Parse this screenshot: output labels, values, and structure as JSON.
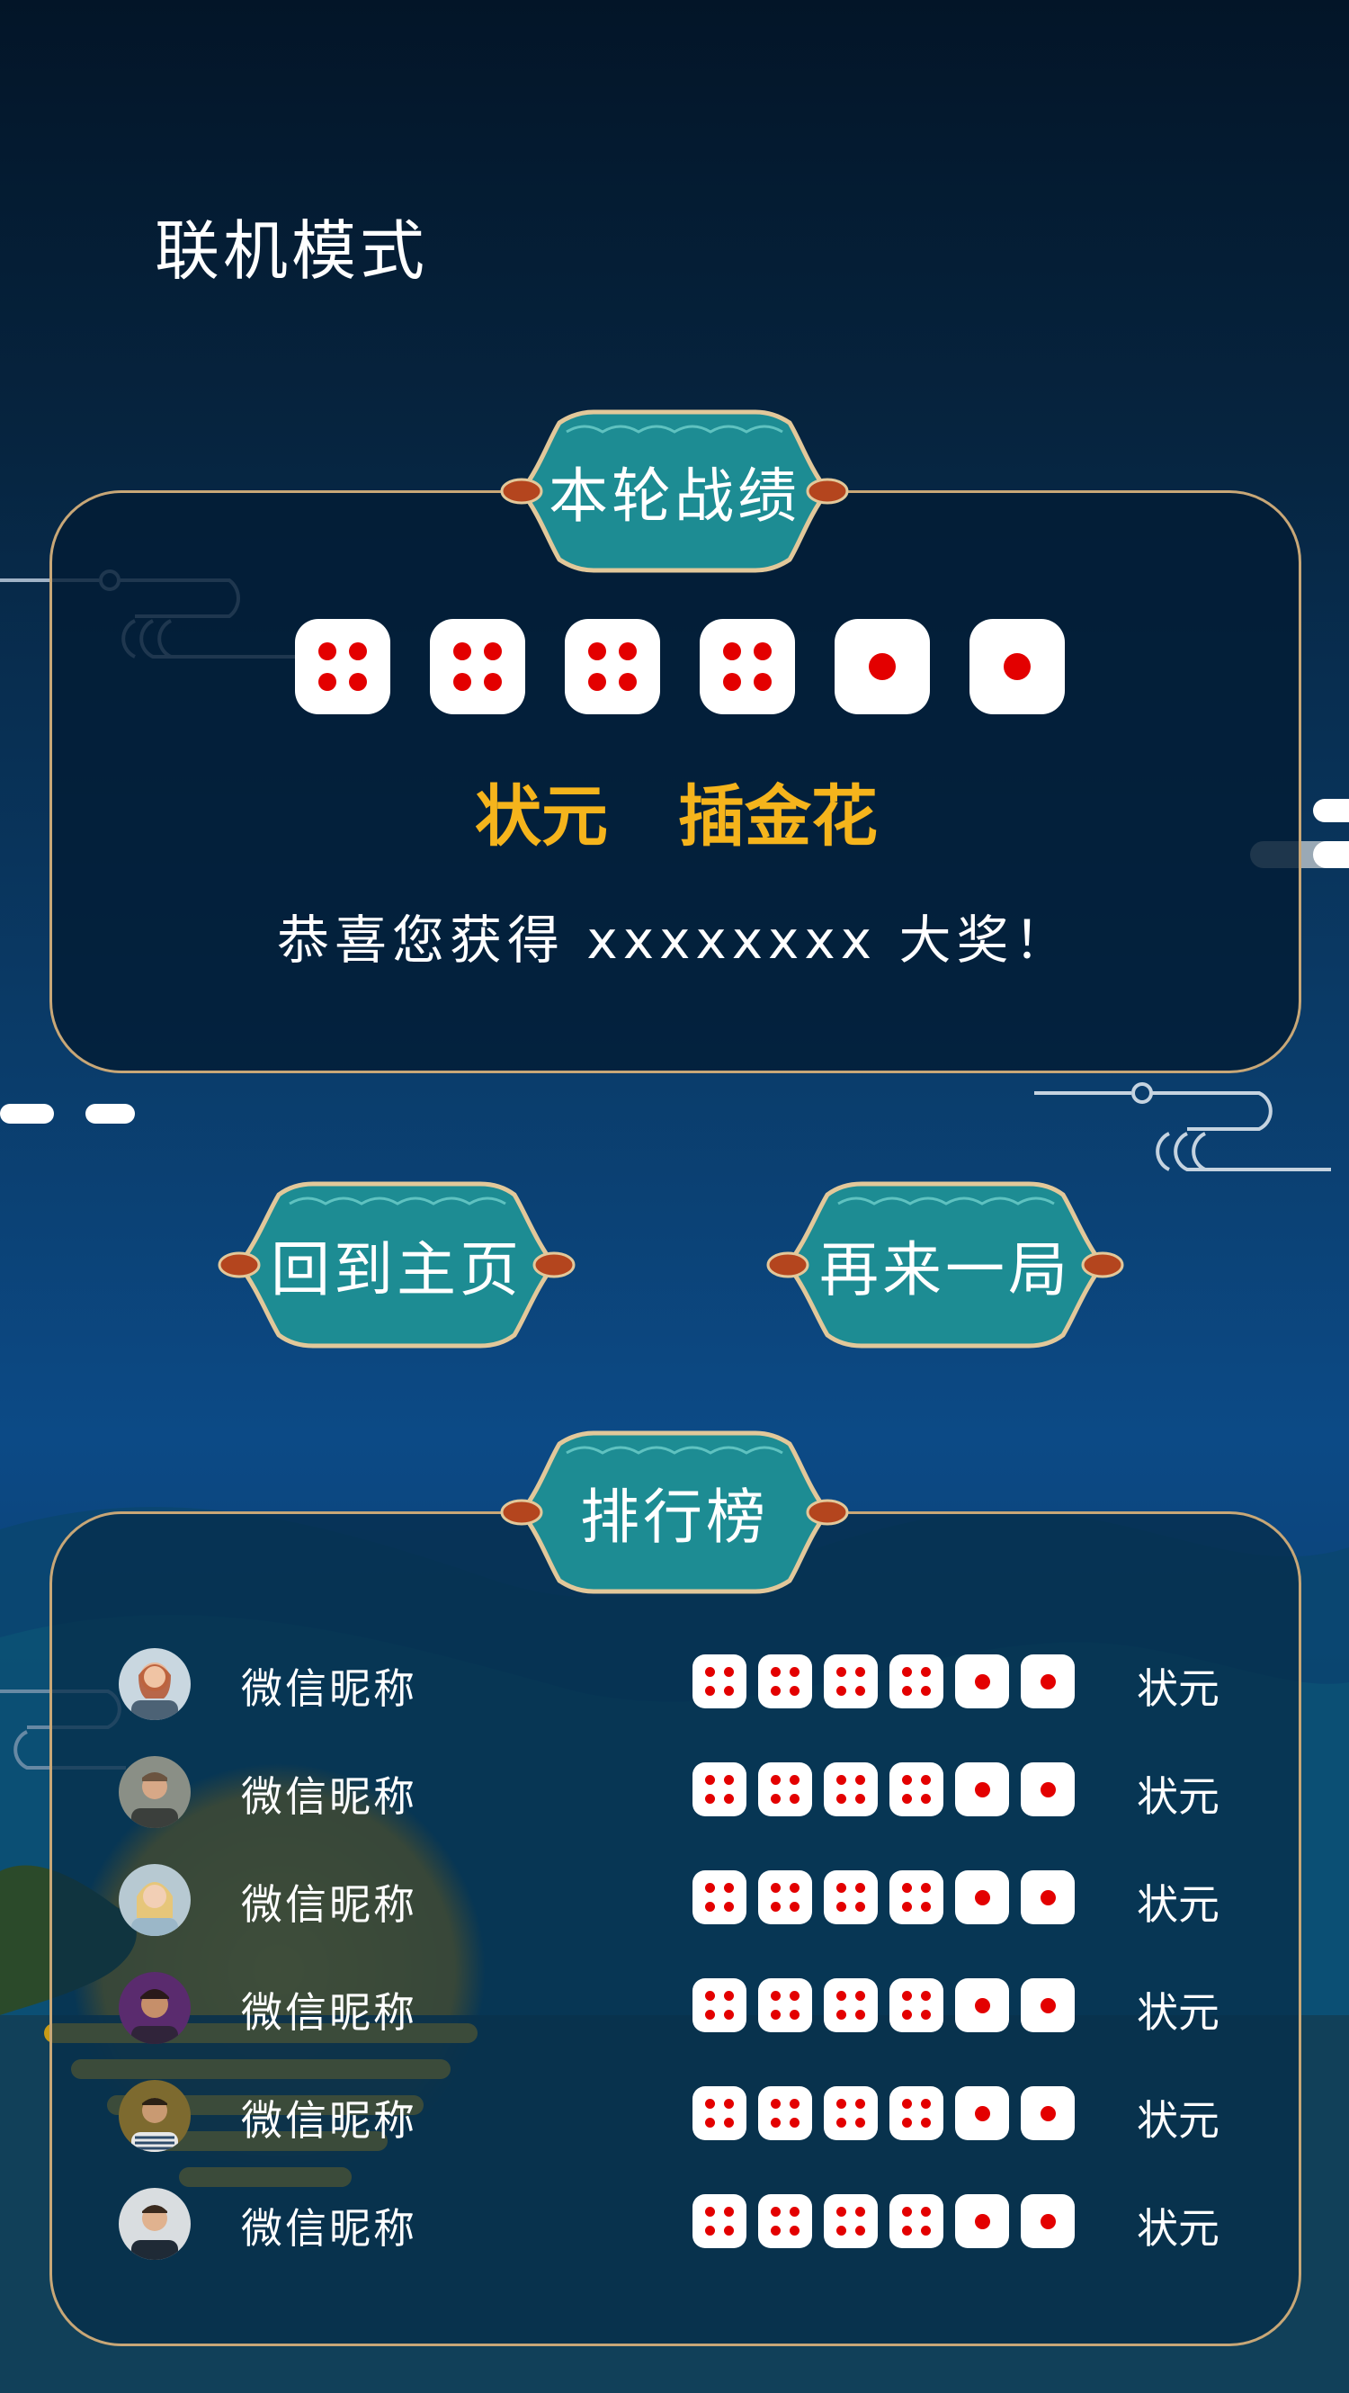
{
  "page_title": "联机模式",
  "round_result": {
    "badge": "本轮战绩",
    "dice": [
      4,
      4,
      4,
      4,
      1,
      1
    ],
    "result_titles": [
      "状元",
      "插金花"
    ],
    "congrats": "恭喜您获得 xxxxxxxx 大奖！"
  },
  "buttons": {
    "home": "回到主页",
    "again": "再来一局"
  },
  "leaderboard": {
    "badge": "排行榜",
    "rows": [
      {
        "name": "微信昵称",
        "dice": [
          4,
          4,
          4,
          4,
          1,
          1
        ],
        "title": "状元"
      },
      {
        "name": "微信昵称",
        "dice": [
          4,
          4,
          4,
          4,
          1,
          1
        ],
        "title": "状元"
      },
      {
        "name": "微信昵称",
        "dice": [
          4,
          4,
          4,
          4,
          1,
          1
        ],
        "title": "状元"
      },
      {
        "name": "微信昵称",
        "dice": [
          4,
          4,
          4,
          4,
          1,
          1
        ],
        "title": "状元"
      },
      {
        "name": "微信昵称",
        "dice": [
          4,
          4,
          4,
          4,
          1,
          1
        ],
        "title": "状元"
      },
      {
        "name": "微信昵称",
        "dice": [
          4,
          4,
          4,
          4,
          1,
          1
        ],
        "title": "状元"
      }
    ]
  },
  "colors": {
    "accent_gold": "#f5b41c",
    "border_gold": "#c8a777",
    "badge_teal": "#1f8e93",
    "pip_red": "#e30000"
  }
}
